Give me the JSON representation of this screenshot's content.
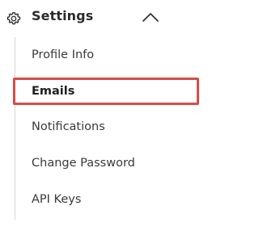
{
  "header": {
    "title": "Settings",
    "icon": "gear-icon",
    "toggle_icon": "chevron-up-icon",
    "expanded": true
  },
  "menu": {
    "items": [
      {
        "label": "Profile Info",
        "active": false
      },
      {
        "label": "Emails",
        "active": true
      },
      {
        "label": "Notifications",
        "active": false
      },
      {
        "label": "Change Password",
        "active": false
      },
      {
        "label": "API Keys",
        "active": false
      }
    ]
  },
  "colors": {
    "text": "#2b2b2b",
    "rail": "#d6d6d6",
    "highlight_border": "#d94b4b"
  }
}
